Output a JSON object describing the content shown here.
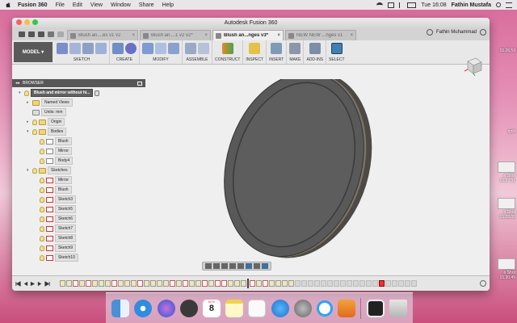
{
  "menubar": {
    "app": "Fusion 360",
    "items": [
      "File",
      "Edit",
      "View",
      "Window",
      "Share",
      "Help"
    ],
    "clock": "Tue 16:08",
    "user": "Fathin Mustafa"
  },
  "window": {
    "title": "Autodesk Fusion 360",
    "tabs": [
      {
        "label": "Blush an....es v1 v2",
        "active": false
      },
      {
        "label": "Blush an....1 v2 v2*",
        "active": false
      },
      {
        "label": "Blush an...nges v3*",
        "active": true
      },
      {
        "label": "NEW NEW ...nges v1",
        "active": false
      }
    ],
    "user_name": "Fathin Muhammad"
  },
  "toolbar": {
    "workspace": "MODEL",
    "groups": [
      "SKETCH",
      "CREATE",
      "MODIFY",
      "ASSEMBLE",
      "CONSTRUCT",
      "INSPECT",
      "INSERT",
      "MAKE",
      "ADD-INS",
      "SELECT"
    ]
  },
  "browser": {
    "header": "BROWSER",
    "root": "Blush and mirror without hi...",
    "named_views": "Named Views",
    "units": "Units: mm",
    "origin": "Origin",
    "bodies": "Bodies",
    "body_items": [
      "Blush",
      "Mirror",
      "Body4"
    ],
    "sketches": "Sketches",
    "sketch_items": [
      "Mirror",
      "Blush",
      "Sketch3",
      "Sketch5",
      "Sketch6",
      "Sketch7",
      "Sketch8",
      "Sketch9",
      "Sketch10"
    ]
  },
  "desktop": {
    "labels": [
      "15.26.59",
      "igns",
      "n Shot",
      "15.27.31",
      "n Shot",
      "15.28.08",
      "n Shot",
      "15.30.45"
    ]
  },
  "dock": {
    "calendar_month": "NOV",
    "calendar_day": "8"
  }
}
